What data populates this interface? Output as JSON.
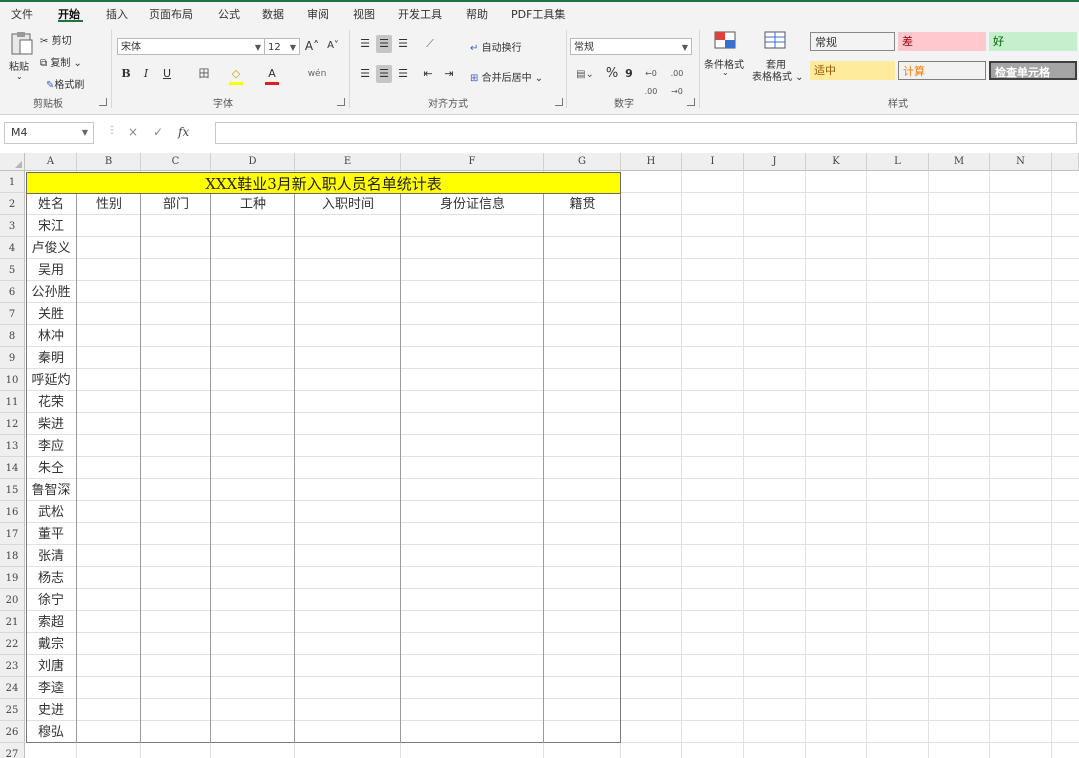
{
  "menu": {
    "tabs": [
      "文件",
      "开始",
      "插入",
      "页面布局",
      "公式",
      "数据",
      "审阅",
      "视图",
      "开发工具",
      "帮助",
      "PDF工具集"
    ],
    "active": "开始"
  },
  "ribbon": {
    "clipboard": {
      "paste": "粘贴",
      "cut": "剪切",
      "copy": "复制",
      "format_painter": "格式刷",
      "label": "剪贴板"
    },
    "font": {
      "name": "宋体",
      "size": "12",
      "grow": "A˄",
      "shrink": "A˅",
      "bold": "B",
      "italic": "I",
      "underline": "U",
      "border": "田",
      "fill": "◇",
      "font_color": "A",
      "phonetic": "wén",
      "label": "字体"
    },
    "alignment": {
      "wrap": "自动换行",
      "merge": "合并后居中",
      "label": "对齐方式"
    },
    "number": {
      "format": "常规",
      "percent": "%",
      "comma": "9",
      "inc_dec": "←0 .00",
      "dec_dec": ".00 →0",
      "label": "数字"
    },
    "styles": {
      "conditional": "条件格式",
      "table_format": "套用\n表格格式",
      "cells": [
        {
          "text": "常规",
          "bg": "#ffffff",
          "fg": "#000000"
        },
        {
          "text": "差",
          "bg": "#ffc7ce",
          "fg": "#9c0006"
        },
        {
          "text": "好",
          "bg": "#c6efce",
          "fg": "#006100"
        },
        {
          "text": "适中",
          "bg": "#ffeb9c",
          "fg": "#9c5700"
        },
        {
          "text": "计算",
          "bg": "#f2f2f2",
          "fg": "#fa7d00"
        },
        {
          "text": "检查单元格",
          "bg": "#a5a5a5",
          "fg": "#ffffff"
        }
      ],
      "label": "样式"
    }
  },
  "formula_bar": {
    "name_box": "M4",
    "cancel": "×",
    "enter": "✓",
    "fx": "fx",
    "value": ""
  },
  "sheet": {
    "columns": [
      "A",
      "B",
      "C",
      "D",
      "E",
      "F",
      "G",
      "H",
      "I",
      "J",
      "K",
      "L",
      "M",
      "N"
    ],
    "rows": [
      "1",
      "2",
      "3",
      "4",
      "5",
      "6",
      "7",
      "8",
      "9",
      "10",
      "11",
      "12",
      "13",
      "14",
      "15",
      "16",
      "17",
      "18",
      "19",
      "20",
      "21",
      "22",
      "23",
      "24",
      "25",
      "26",
      "27"
    ],
    "title": "XXX鞋业3月新入职人员名单统计表",
    "headers": [
      "姓名",
      "性别",
      "部门",
      "工种",
      "入职时间",
      "身份证信息",
      "籍贯"
    ],
    "names": [
      "宋江",
      "卢俊义",
      "吴用",
      "公孙胜",
      "关胜",
      "林冲",
      "秦明",
      "呼延灼",
      "花荣",
      "柴进",
      "李应",
      "朱仝",
      "鲁智深",
      "武松",
      "董平",
      "张清",
      "杨志",
      "徐宁",
      "索超",
      "戴宗",
      "刘唐",
      "李逵",
      "史进",
      "穆弘"
    ]
  },
  "colors": {
    "accent": "#217346",
    "title_fill": "#ffff00"
  }
}
